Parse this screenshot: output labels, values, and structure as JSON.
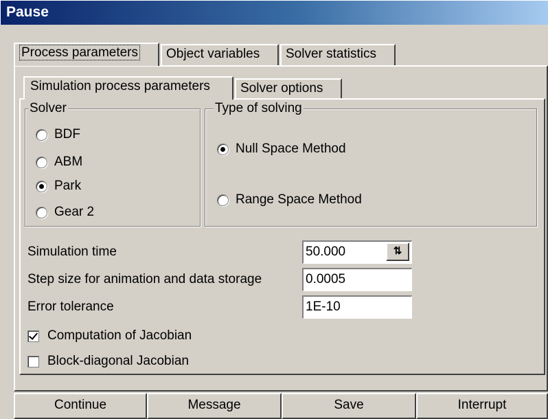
{
  "window": {
    "title": "Pause"
  },
  "outer_tabs": [
    "Process parameters",
    "Object variables",
    "Solver statistics"
  ],
  "inner_tabs": [
    "Simulation process parameters",
    "Solver options"
  ],
  "solver_group": {
    "legend": "Solver",
    "options": [
      "BDF",
      "ABM",
      "Park",
      "Gear 2"
    ],
    "selected": "Park"
  },
  "solving_group": {
    "legend": "Type of solving",
    "options": [
      "Null Space Method",
      "Range Space Method"
    ],
    "selected": "Null Space Method"
  },
  "params": {
    "sim_time_label": "Simulation time",
    "sim_time_value": "50.000",
    "step_label": "Step size for animation and data storage",
    "step_value": "0.0005",
    "tol_label": "Error tolerance",
    "tol_value": "1E-10"
  },
  "checks": {
    "jacobian_label": "Computation of Jacobian",
    "jacobian_checked": true,
    "block_label": "Block-diagonal Jacobian",
    "block_checked": false
  },
  "buttons": {
    "continue": "Continue",
    "message": "Message",
    "save": "Save",
    "interrupt": "Interrupt"
  }
}
